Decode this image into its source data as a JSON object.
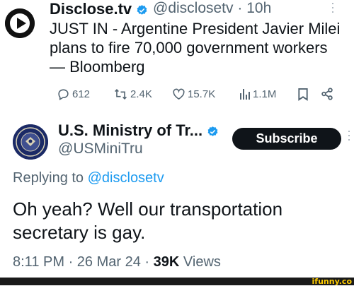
{
  "tweet1": {
    "name": "Disclose.tv",
    "handle": "@disclosetv",
    "separator": "·",
    "time": "10h",
    "text_lines": [
      "JUST IN - Argentine President Javier Milei",
      "plans to fire 70,000 government workers",
      "— Bloomberg"
    ],
    "actions": {
      "replies": "612",
      "retweets": "2.4K",
      "likes": "15.7K",
      "views": "1.1M"
    }
  },
  "tweet2": {
    "name": "U.S. Ministry of Tr...",
    "handle": "@USMiniTru",
    "subscribe_label": "Subscribe",
    "replying_prefix": "Replying to",
    "replying_handle": "@disclosetv",
    "text_lines": [
      "Oh yeah? Well our transportation",
      "secretary is gay."
    ],
    "time": "8:11 PM",
    "date": "26 Mar 24",
    "views_count": "39K",
    "views_label": "Views",
    "separator": "·"
  },
  "watermark": "ifunny.co",
  "colors": {
    "text": "#0f1419",
    "secondary": "#536471",
    "accent": "#1d9bf0",
    "button": "#0f1419",
    "watermark": "#ffcc00"
  }
}
